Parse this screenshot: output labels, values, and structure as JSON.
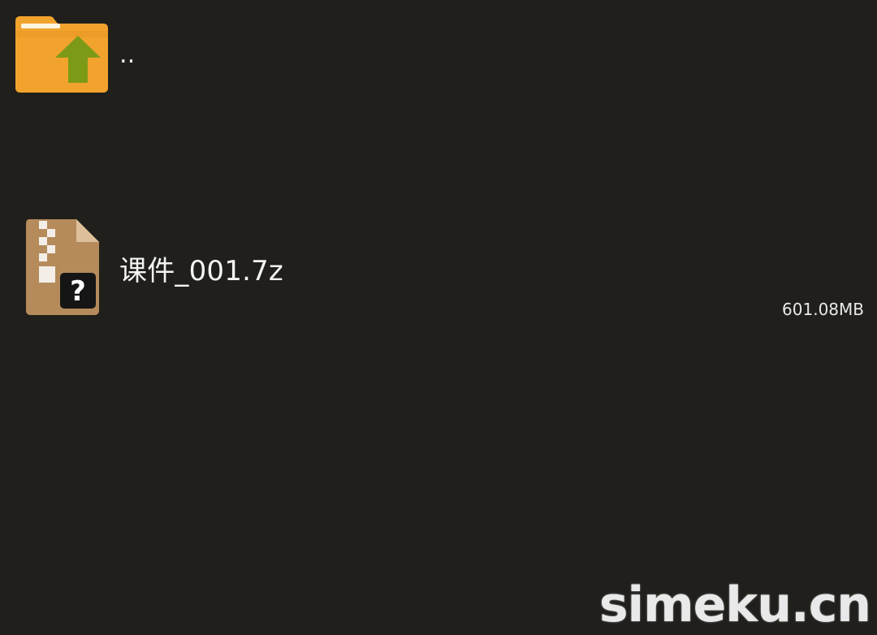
{
  "file_list": {
    "parent": {
      "name": "..",
      "icon": "folder-up-icon"
    },
    "files": [
      {
        "name": "课件_001.7z",
        "size": "601.08MB",
        "icon": "archive-unknown-icon"
      }
    ]
  },
  "watermark": {
    "text": "simeku.cn"
  },
  "colors": {
    "background": "#201f1c",
    "folder": "#f2a32e",
    "folder_arrow": "#7d9a17",
    "archive": "#b58b5b"
  }
}
